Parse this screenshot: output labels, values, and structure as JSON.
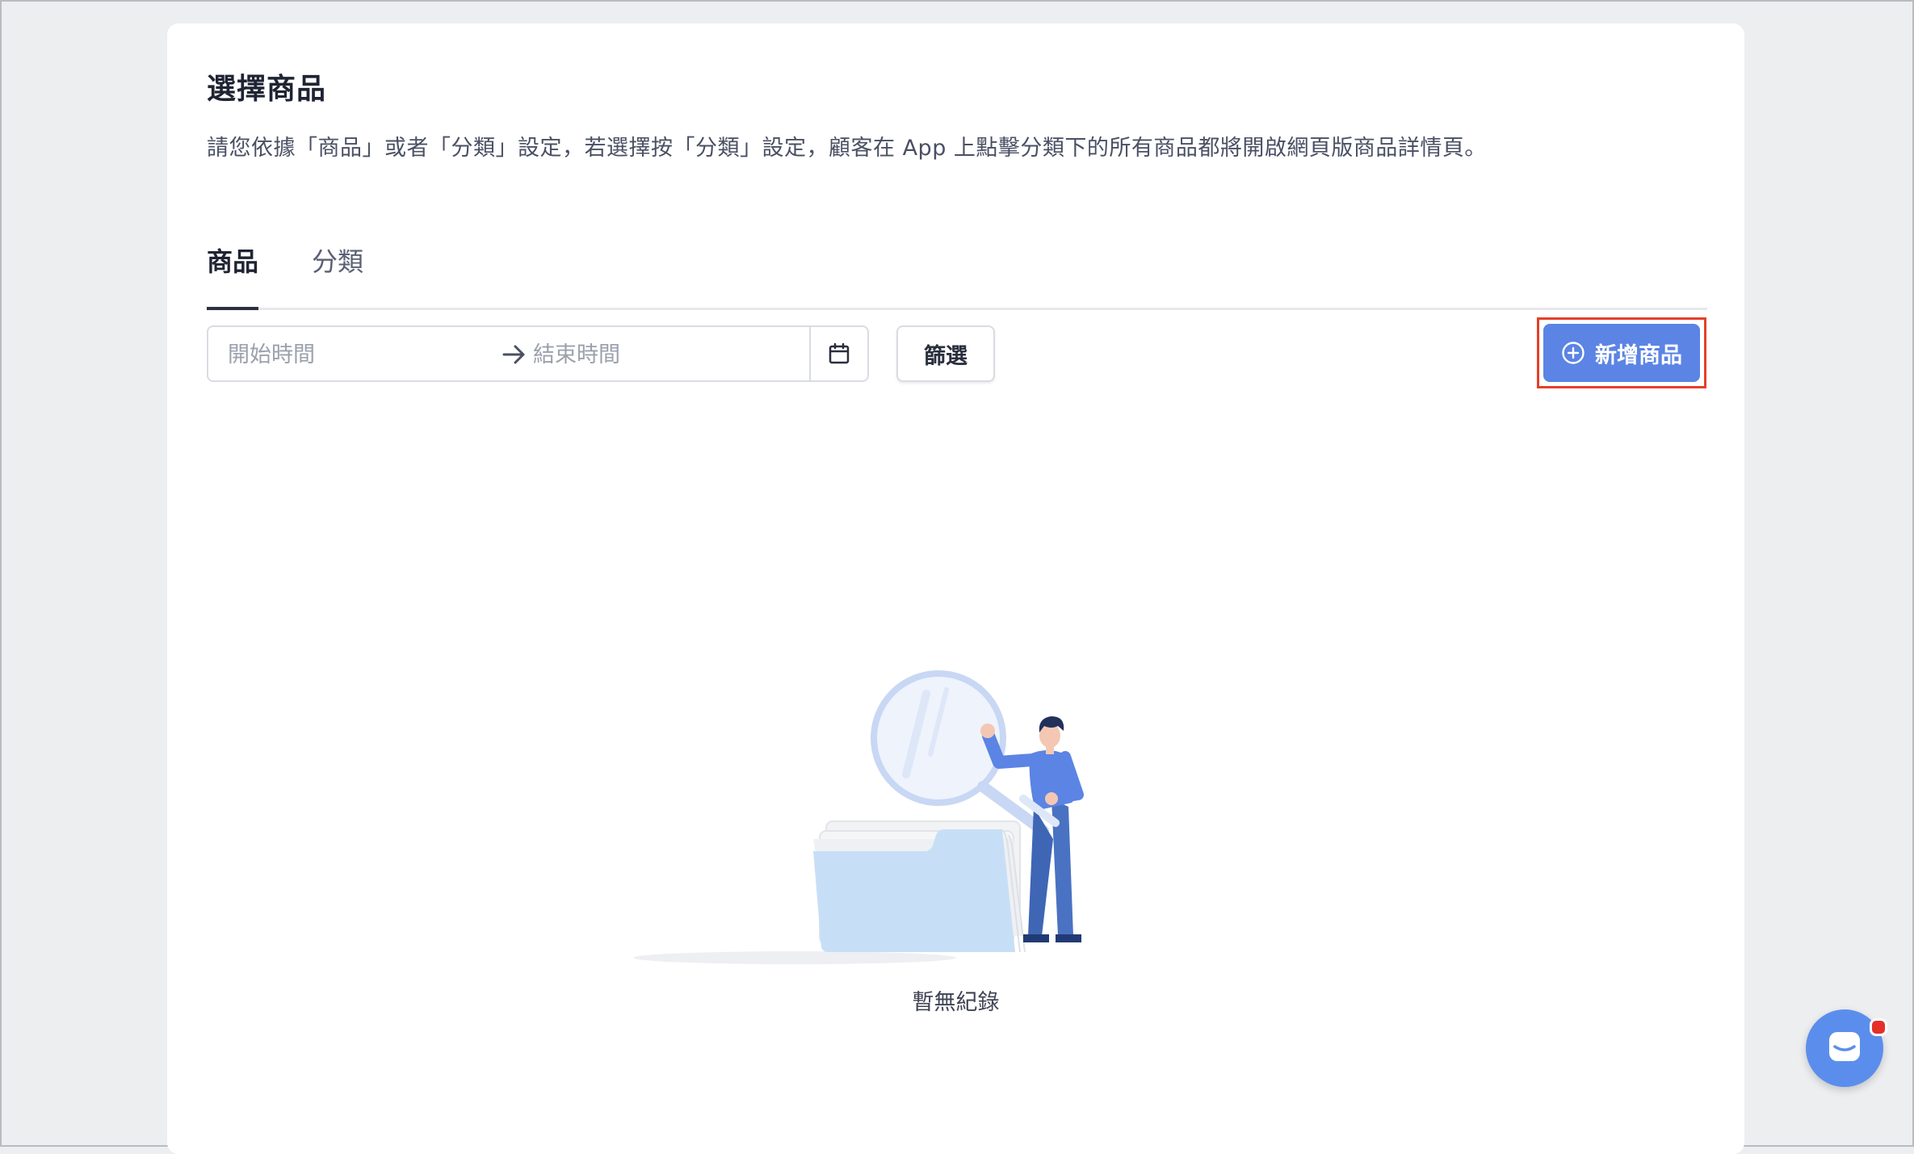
{
  "section": {
    "title": "選擇商品",
    "description": "請您依據「商品」或者「分類」設定，若選擇按「分類」設定，顧客在 App 上點擊分類下的所有商品都將開啟網頁版商品詳情頁。"
  },
  "tabs": [
    {
      "label": "商品",
      "active": true
    },
    {
      "label": "分類",
      "active": false
    }
  ],
  "date_range": {
    "start_placeholder": "開始時間",
    "end_placeholder": "結束時間",
    "start_value": "",
    "end_value": "",
    "separator_icon": "arrow-right-icon",
    "calendar_icon": "calendar-icon"
  },
  "filter_button": {
    "label": "篩選"
  },
  "add_button": {
    "label": "新增商品",
    "icon": "plus-circle-icon"
  },
  "empty_state": {
    "text": "暫無紀錄",
    "illustration": "person-with-magnifier-and-folder"
  },
  "chat_widget": {
    "icon": "chat-icon",
    "has_notification": true
  },
  "colors": {
    "primary": "#5b84e4",
    "highlight_border": "#e5402a",
    "notification": "#e5302a",
    "text_dark": "#1f2433",
    "background": "#edeef0"
  }
}
